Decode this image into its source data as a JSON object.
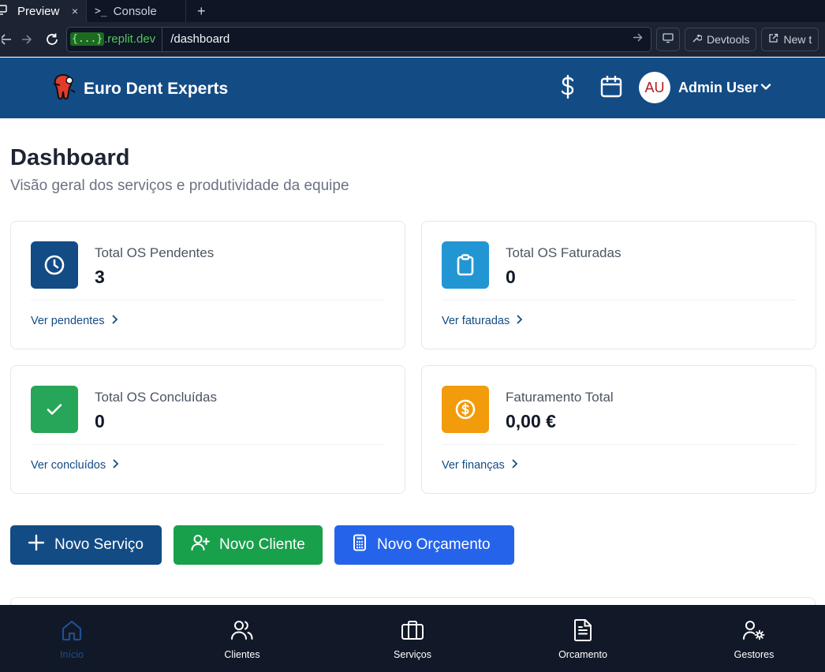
{
  "browser": {
    "tabs": [
      {
        "label": "Preview",
        "icon": "monitor-icon"
      },
      {
        "label": "Console",
        "icon": "terminal-icon"
      }
    ],
    "url_domain_badge": "{...}",
    "url_domain": ".replit.dev",
    "url_path": "/dashboard",
    "devtools_label": "Devtools",
    "new_tab_label": "New t"
  },
  "header": {
    "brand": "Euro Dent Experts",
    "avatar_initials": "AU",
    "user_name": "Admin User"
  },
  "page": {
    "title": "Dashboard",
    "subtitle": "Visão geral dos serviços e produtividade da equipe"
  },
  "cards": [
    {
      "label": "Total OS Pendentes",
      "value": "3",
      "link": "Ver pendentes",
      "icon": "clock-icon",
      "color": "#134b85"
    },
    {
      "label": "Total OS Faturadas",
      "value": "0",
      "link": "Ver faturadas",
      "icon": "clipboard-icon",
      "color": "#2196d3"
    },
    {
      "label": "Total OS Concluídas",
      "value": "0",
      "link": "Ver concluídos",
      "icon": "check-icon",
      "color": "#27a558"
    },
    {
      "label": "Faturamento Total",
      "value": "0,00 €",
      "link": "Ver finanças",
      "icon": "dollar-coin-icon",
      "color": "#f29b0b"
    }
  ],
  "actions": [
    {
      "label": "Novo Serviço",
      "icon": "plus-icon",
      "color": "#134b85"
    },
    {
      "label": "Novo Cliente",
      "icon": "user-plus-icon",
      "color": "#18a04b"
    },
    {
      "label": "Novo Orçamento",
      "icon": "calculator-icon",
      "color": "#2563eb"
    }
  ],
  "bottom_nav": [
    {
      "label": "Início",
      "icon": "home-icon",
      "active": true
    },
    {
      "label": "Clientes",
      "icon": "users-icon"
    },
    {
      "label": "Serviços",
      "icon": "briefcase-icon"
    },
    {
      "label": "Orcamento",
      "icon": "file-text-icon"
    },
    {
      "label": "Gestores",
      "icon": "user-gear-icon"
    }
  ],
  "colors": {
    "header_bg": "#134b85",
    "nav_bg": "#111827",
    "nav_active": "#1f4f8d"
  }
}
